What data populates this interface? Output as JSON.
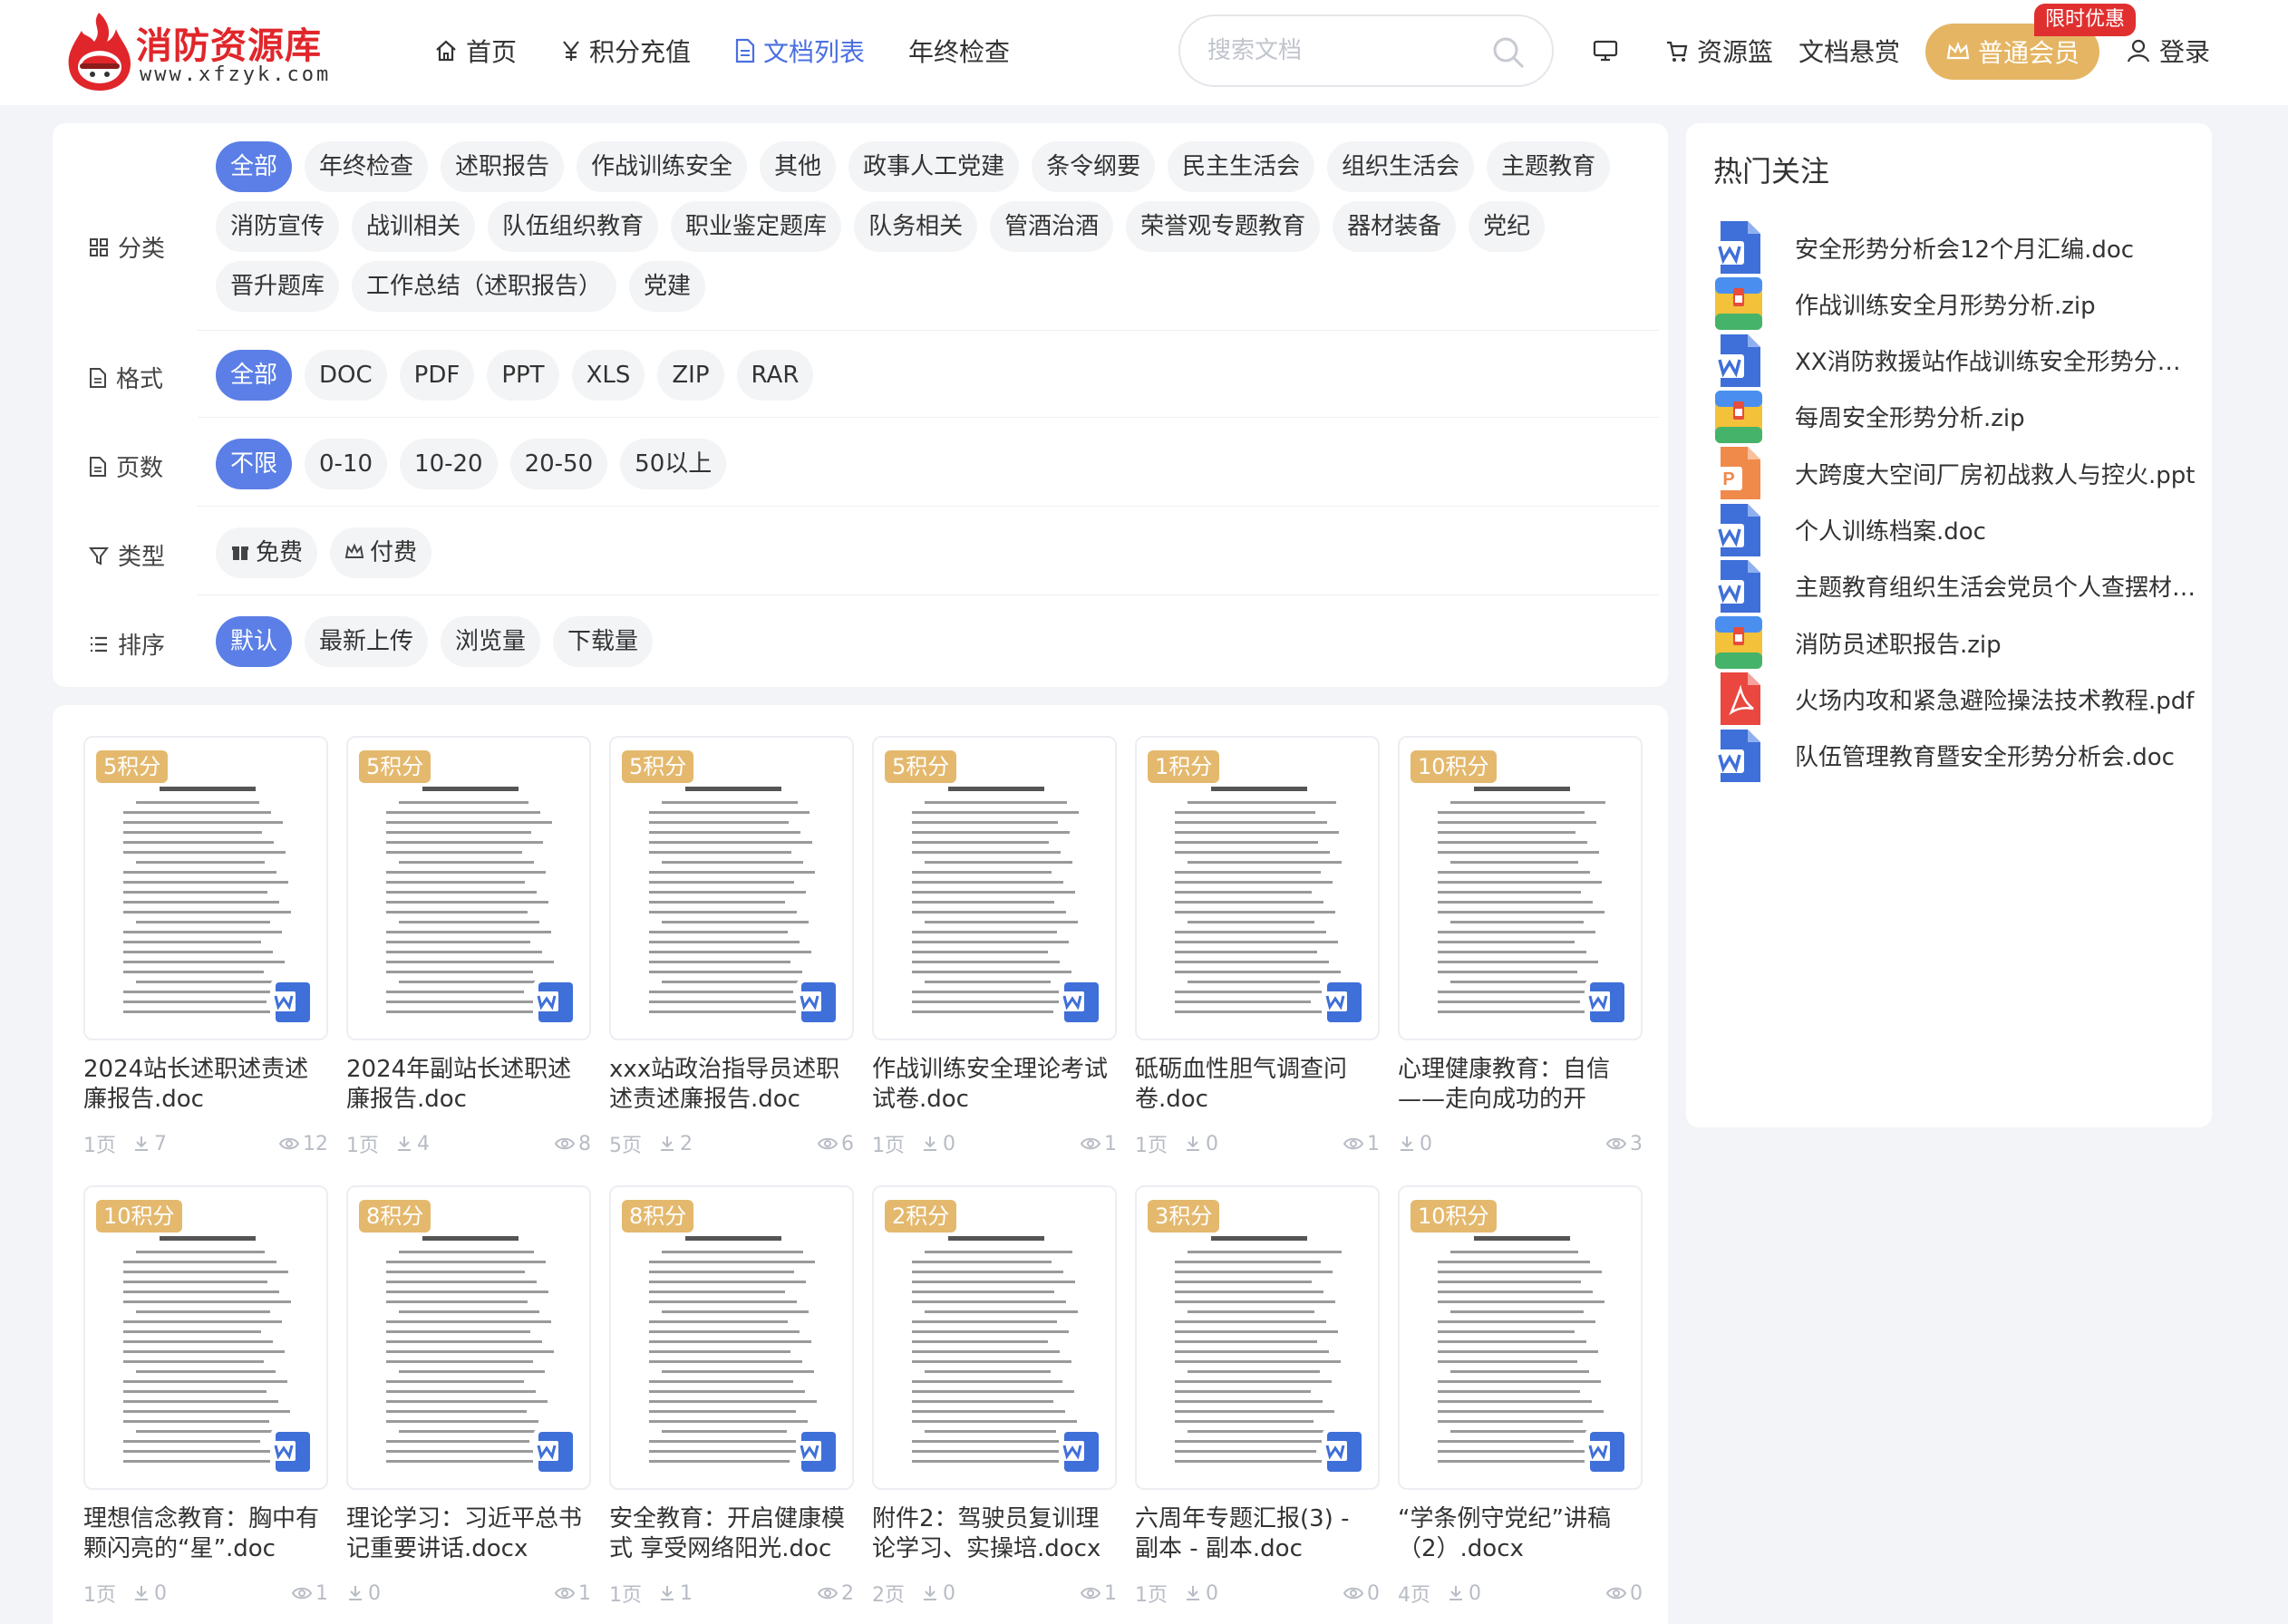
{
  "brand": {
    "title": "消防资源库",
    "url": "www.xfzyk.com"
  },
  "nav": [
    {
      "label": "首页",
      "icon": "home-icon"
    },
    {
      "label": "积分充值",
      "icon": "yen-icon"
    },
    {
      "label": "文档列表",
      "icon": "document-icon",
      "active": true
    },
    {
      "label": "年终检查",
      "icon": ""
    }
  ],
  "search": {
    "placeholder": "搜索文档",
    "value": ""
  },
  "header_right": {
    "basket": "资源篮",
    "reward": "文档悬赏",
    "vip": "普通会员",
    "promo": "限时优惠",
    "login": "登录"
  },
  "filters": {
    "category": {
      "label": "分类",
      "items": [
        "全部",
        "年终检查",
        "述职报告",
        "作战训练安全",
        "其他",
        "政事人工党建",
        "条令纲要",
        "民主生活会",
        "组织生活会",
        "主题教育",
        "消防宣传",
        "战训相关",
        "队伍组织教育",
        "职业鉴定题库",
        "队务相关",
        "管酒治酒",
        "荣誉观专题教育",
        "器材装备",
        "党纪",
        "晋升题库",
        "工作总结（述职报告）",
        "党建"
      ]
    },
    "format": {
      "label": "格式",
      "items": [
        "全部",
        "DOC",
        "PDF",
        "PPT",
        "XLS",
        "ZIP",
        "RAR"
      ]
    },
    "pages": {
      "label": "页数",
      "items": [
        "不限",
        "0-10",
        "10-20",
        "20-50",
        "50以上"
      ]
    },
    "type": {
      "label": "类型",
      "items": [
        "免费",
        "付费"
      ]
    },
    "sort": {
      "label": "排序",
      "items": [
        "默认",
        "最新上传",
        "浏览量",
        "下载量"
      ]
    }
  },
  "hot": {
    "title": "热门关注",
    "items": [
      {
        "name": "安全形势分析会12个月汇编.doc",
        "type": "word"
      },
      {
        "name": "作战训练安全月形势分析.zip",
        "type": "zip"
      },
      {
        "name": "XX消防救援站作战训练安全形势分析会.doc",
        "type": "word"
      },
      {
        "name": "每周安全形势分析.zip",
        "type": "zip"
      },
      {
        "name": "大跨度大空间厂房初战救人与控火.ppt",
        "type": "ppt"
      },
      {
        "name": "个人训练档案.doc",
        "type": "word"
      },
      {
        "name": "主题教育组织生活会党员个人查摆材料.doc",
        "type": "word"
      },
      {
        "name": "消防员述职报告.zip",
        "type": "zip"
      },
      {
        "name": "火场内攻和紧急避险操法技术教程.pdf",
        "type": "pdf"
      },
      {
        "name": "队伍管理教育暨安全形势分析会.doc",
        "type": "word"
      }
    ]
  },
  "docs": [
    {
      "badge": "5积分",
      "title": "2024站长述职述责述廉报告.doc",
      "pages": "1页",
      "downloads": "7",
      "views": "12"
    },
    {
      "badge": "5积分",
      "title": "2024年副站长述职述廉报告.doc",
      "pages": "1页",
      "downloads": "4",
      "views": "8"
    },
    {
      "badge": "5积分",
      "title": "xxx站政治指导员述职述责述廉报告.doc",
      "pages": "5页",
      "downloads": "2",
      "views": "6"
    },
    {
      "badge": "5积分",
      "title": "作战训练安全理论考试试卷.doc",
      "pages": "1页",
      "downloads": "0",
      "views": "1"
    },
    {
      "badge": "1积分",
      "title": "砥砺血性胆气调查问卷.doc",
      "pages": "1页",
      "downloads": "0",
      "views": "1"
    },
    {
      "badge": "10积分",
      "title": "心理健康教育：自信——走向成功的开",
      "pages": "",
      "downloads": "0",
      "views": "3"
    },
    {
      "badge": "10积分",
      "title": "理想信念教育：胸中有颗闪亮的“星”.doc",
      "pages": "1页",
      "downloads": "0",
      "views": "1"
    },
    {
      "badge": "8积分",
      "title": "理论学习：习近平总书记重要讲话.docx",
      "pages": "",
      "downloads": "0",
      "views": "1"
    },
    {
      "badge": "8积分",
      "title": "安全教育：开启健康模式 享受网络阳光.doc",
      "pages": "1页",
      "downloads": "1",
      "views": "2"
    },
    {
      "badge": "2积分",
      "title": "附件2：驾驶员复训理论学习、实操培.docx",
      "pages": "2页",
      "downloads": "0",
      "views": "1"
    },
    {
      "badge": "3积分",
      "title": "六周年专题汇报(3) - 副本 - 副本.doc",
      "pages": "1页",
      "downloads": "0",
      "views": "0"
    },
    {
      "badge": "10积分",
      "title": "“学条例守党纪”讲稿（2）.docx",
      "pages": "4页",
      "downloads": "0",
      "views": "0"
    }
  ],
  "colors": {
    "accent": "#4a6fe0",
    "chip_active": "#5b7fe6",
    "badge": "#e4b96e",
    "vip": "#e5b563",
    "promo": "#e02f2f",
    "brand": "#e0262b"
  }
}
